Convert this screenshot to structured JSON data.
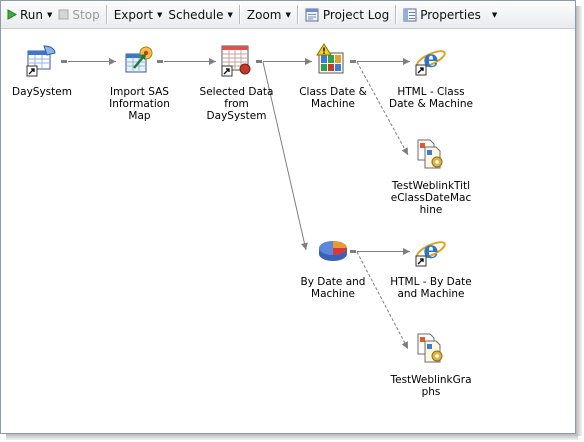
{
  "toolbar": {
    "run_label": "Run",
    "stop_label": "Stop",
    "export_label": "Export",
    "schedule_label": "Schedule",
    "zoom_label": "Zoom",
    "project_log_label": "Project Log",
    "properties_label": "Properties"
  },
  "nodes": {
    "daysystem": {
      "label": "DaySystem",
      "icon": "data-table-shortcut-icon"
    },
    "import_sas": {
      "label": "Import SAS\nInformation Map",
      "icon": "import-information-map-icon"
    },
    "selected_data": {
      "label": "Selected Data\nfrom\nDaySystem",
      "icon": "query-table-shortcut-icon"
    },
    "class_date": {
      "label": "Class Date &\nMachine",
      "icon": "warning-chart-icon"
    },
    "html_class": {
      "label": "HTML - Class\nDate & Machine",
      "icon": "internet-explorer-icon"
    },
    "weblink_title": {
      "label": "TestWeblinkTitl\neClassDateMac\nhine",
      "icon": "document-gear-icon"
    },
    "by_date": {
      "label": "By Date and\nMachine",
      "icon": "pie-chart-icon"
    },
    "html_by_date": {
      "label": "HTML - By Date\nand Machine",
      "icon": "internet-explorer-icon"
    },
    "weblink_graphs": {
      "label": "TestWeblinkGra\nphs",
      "icon": "document-gear-icon"
    }
  },
  "colors": {
    "connector": "#7f7f7f",
    "toolbar_top": "#fdfdfd",
    "toolbar_bottom": "#e9ebef",
    "frame_border": "#8f9aa8"
  }
}
